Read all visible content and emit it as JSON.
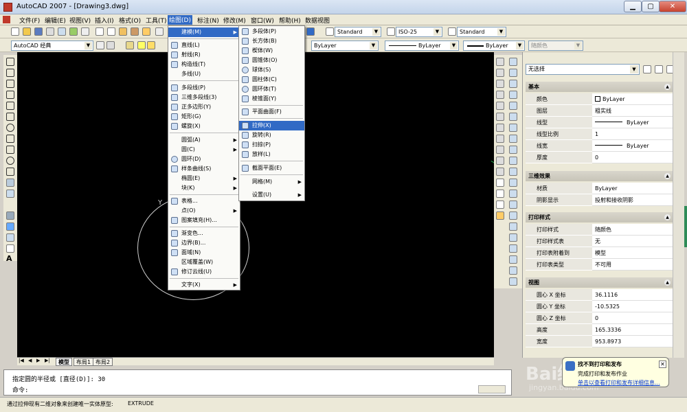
{
  "window": {
    "title": "AutoCAD 2007 - [Drawing3.dwg]",
    "min": "▁",
    "max": "▢",
    "close": "✕"
  },
  "menubar": [
    "文件(F)",
    "编辑(E)",
    "视图(V)",
    "插入(I)",
    "格式(O)",
    "工具(T)",
    "绘图(D)",
    "标注(N)",
    "修改(M)",
    "窗口(W)",
    "帮助(H)",
    "数据视图"
  ],
  "toolbar": {
    "text_style": "Standard",
    "dim_style": "ISO-25",
    "table_style": "Standard",
    "workspace": "AutoCAD 经典",
    "color": "ByLayer",
    "linetype": "ByLayer",
    "lineweight": "ByLayer",
    "plotstyle": "随颜色"
  },
  "draw_menu": {
    "items": [
      "建模(M)",
      "直线(L)",
      "射线(R)",
      "构造线(T)",
      "多线(U)",
      "多段线(P)",
      "三维多段线(3)",
      "正多边形(Y)",
      "矩形(G)",
      "螺旋(X)",
      "圆弧(A)",
      "圆(C)",
      "圆环(D)",
      "样条曲线(S)",
      "椭圆(E)",
      "块(K)",
      "表格...",
      "点(O)",
      "图案填充(H)...",
      "渐变色...",
      "边界(B)...",
      "面域(N)",
      "区域覆盖(W)",
      "修订云线(U)",
      "文字(X)"
    ]
  },
  "modeling_menu": {
    "items": [
      "多段体(P)",
      "长方体(B)",
      "楔体(W)",
      "圆锥体(O)",
      "球体(S)",
      "圆柱体(C)",
      "圆环体(T)",
      "棱锥面(Y)",
      "平面曲面(F)",
      "拉伸(X)",
      "旋转(R)",
      "扫掠(P)",
      "放样(L)",
      "截面平面(E)",
      "网格(M)",
      "设置(U)"
    ]
  },
  "tabs": [
    "模型",
    "布局1",
    "布局2"
  ],
  "tab_nav": [
    "|◀",
    "◀",
    "▶",
    "▶|"
  ],
  "command": {
    "history": "指定圆的半径或 [直径(D)]: 30",
    "prompt": "命令:"
  },
  "status": {
    "message": "通过拉伸现有二维对象来创建唯一实体原型:",
    "command_name": "EXTRUDE"
  },
  "properties": {
    "selection": "无选择",
    "sections": [
      {
        "title": "基本",
        "rows": [
          [
            "颜色",
            "ByLayer"
          ],
          [
            "图层",
            "粗实线"
          ],
          [
            "线型",
            "ByLayer"
          ],
          [
            "线型比例",
            "1"
          ],
          [
            "线宽",
            "ByLayer"
          ],
          [
            "厚度",
            "0"
          ]
        ]
      },
      {
        "title": "三维效果",
        "rows": [
          [
            "材质",
            "ByLayer"
          ],
          [
            "阴影显示",
            "投射和接收阴影"
          ]
        ]
      },
      {
        "title": "打印样式",
        "rows": [
          [
            "打印样式",
            "随颜色"
          ],
          [
            "打印样式表",
            "无"
          ],
          [
            "打印表附着到",
            "模型"
          ],
          [
            "打印表类型",
            "不可用"
          ]
        ]
      },
      {
        "title": "视图",
        "rows": [
          [
            "圆心 X 坐标",
            "36.1116"
          ],
          [
            "圆心 Y 坐标",
            "-10.5325"
          ],
          [
            "圆心 Z 坐标",
            "0"
          ],
          [
            "高度",
            "165.3336"
          ],
          [
            "宽度",
            "953.8973"
          ]
        ]
      }
    ]
  },
  "ucs_label": "Y",
  "balloon": {
    "title": "找不到打印和发布",
    "line2": "完成打印和发布作业",
    "link": "单击以查看打印和发布详细信息..."
  },
  "watermark": {
    "big": "Bai经验",
    "small": "jingyan.baidu.com"
  },
  "colors": {
    "accent": "#316ac5",
    "canvas": "#000000",
    "chrome": "#ece9d8"
  }
}
